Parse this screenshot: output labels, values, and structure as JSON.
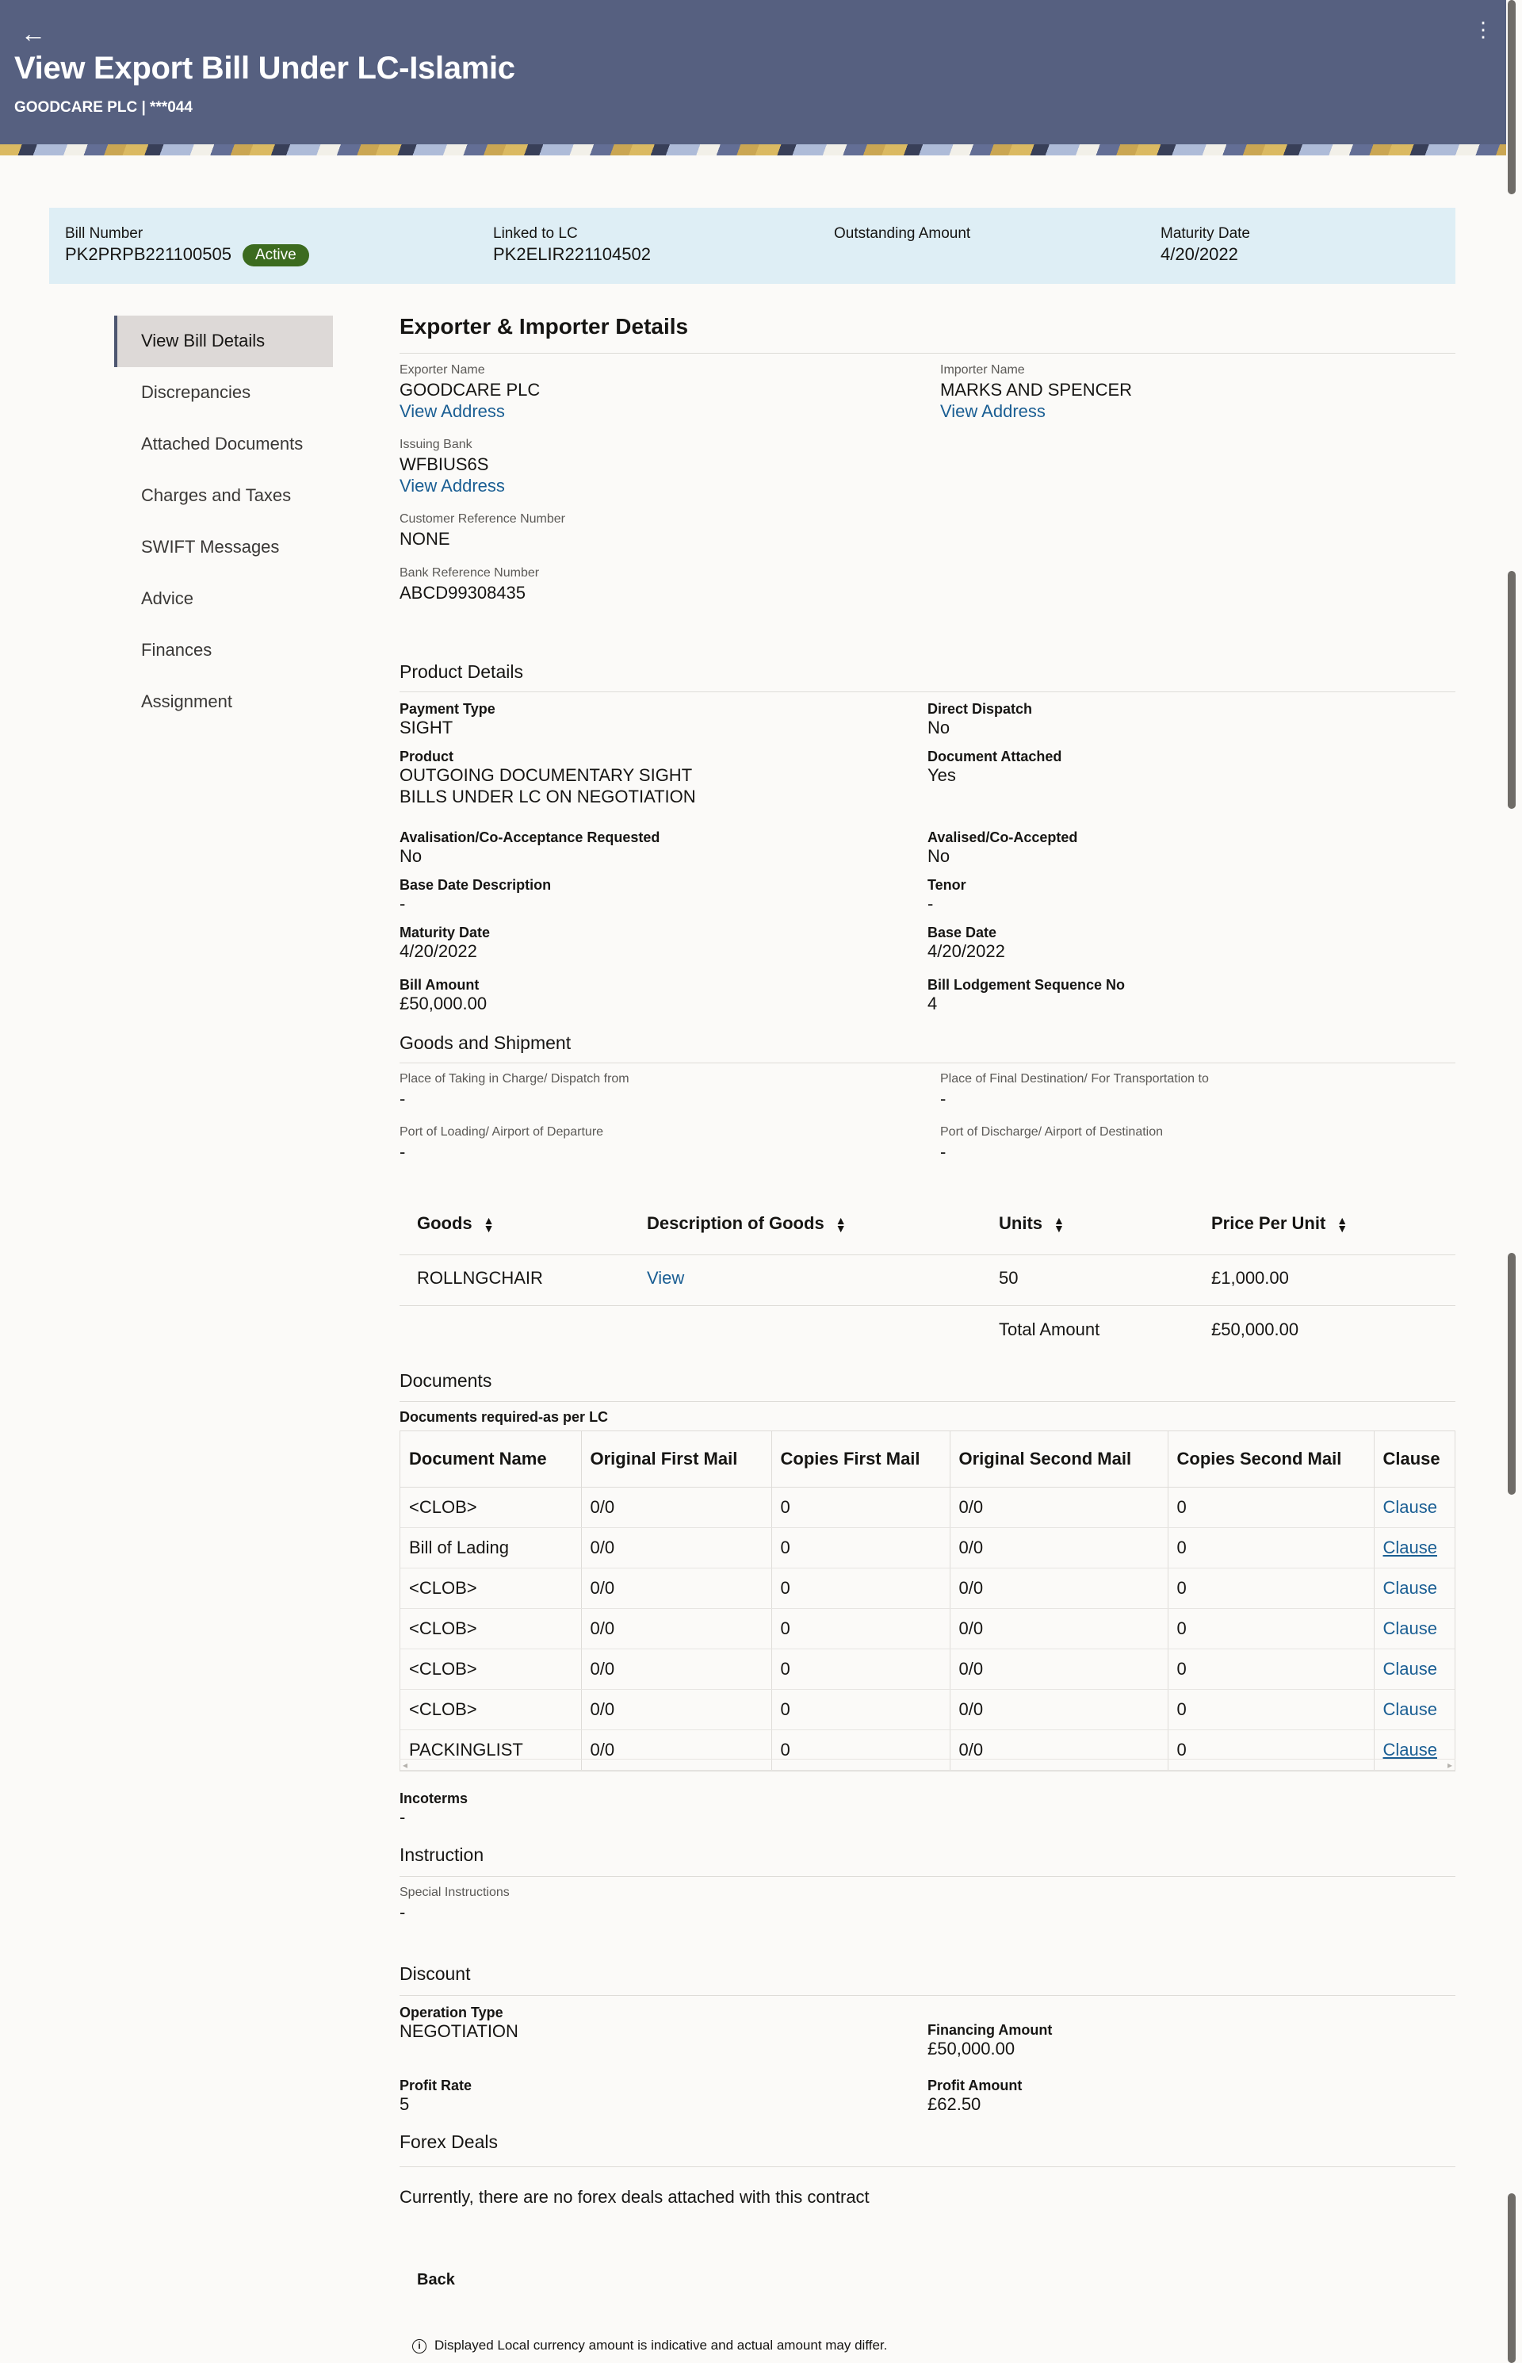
{
  "header": {
    "back_icon": "←",
    "title": "View Export Bill Under LC-Islamic",
    "subtitle": "GOODCARE PLC | ***044",
    "menu_icon": "⋮"
  },
  "summary": {
    "bill_number_label": "Bill Number",
    "bill_number": "PK2PRPB221100505",
    "status": "Active",
    "linked_lc_label": "Linked to LC",
    "linked_lc": "PK2ELIR221104502",
    "outstanding_label": "Outstanding Amount",
    "maturity_label": "Maturity Date",
    "maturity_date": "4/20/2022"
  },
  "nav": {
    "items": [
      "View Bill Details",
      "Discrepancies",
      "Attached Documents",
      "Charges and Taxes",
      "SWIFT Messages",
      "Advice",
      "Finances",
      "Assignment"
    ]
  },
  "exporter_importer": {
    "heading": "Exporter & Importer Details",
    "exporter_name_label": "Exporter Name",
    "exporter_name": "GOODCARE PLC",
    "importer_name_label": "Importer Name",
    "importer_name": "MARKS AND SPENCER",
    "view_address": "View Address",
    "issuing_bank_label": "Issuing Bank",
    "issuing_bank": "WFBIUS6S",
    "customer_ref_label": "Customer Reference Number",
    "customer_ref": "NONE",
    "bank_ref_label": "Bank Reference Number",
    "bank_ref": "ABCD99308435"
  },
  "product": {
    "heading": "Product Details",
    "payment_type_label": "Payment Type",
    "payment_type": "SIGHT",
    "direct_dispatch_label": "Direct Dispatch",
    "direct_dispatch": "No",
    "product_label": "Product",
    "product_line1": "OUTGOING DOCUMENTARY SIGHT",
    "product_line2": "BILLS UNDER LC ON NEGOTIATION",
    "doc_attached_label": "Document Attached",
    "doc_attached": "Yes",
    "avalisation_req_label": "Avalisation/Co-Acceptance Requested",
    "avalisation_req": "No",
    "avalised_label": "Avalised/Co-Accepted",
    "avalised": "No",
    "base_date_desc_label": "Base Date Description",
    "base_date_desc": "-",
    "tenor_label": "Tenor",
    "tenor": "-",
    "maturity_label": "Maturity Date",
    "maturity": "4/20/2022",
    "base_date_label": "Base Date",
    "base_date": "4/20/2022",
    "bill_amount_label": "Bill Amount",
    "bill_amount": "£50,000.00",
    "lodgement_seq_label": "Bill Lodgement Sequence No",
    "lodgement_seq": "4"
  },
  "goods_shipment": {
    "heading": "Goods and Shipment",
    "taking_charge_label": "Place of Taking in Charge/ Dispatch from",
    "taking_charge": "-",
    "final_dest_label": "Place of Final Destination/ For Transportation to",
    "final_dest": "-",
    "port_loading_label": "Port of Loading/ Airport of Departure",
    "port_loading": "-",
    "port_discharge_label": "Port of Discharge/ Airport of Destination",
    "port_discharge": "-"
  },
  "goods_table": {
    "headers": [
      "Goods",
      "Description of Goods",
      "Units",
      "Price Per Unit"
    ],
    "row": {
      "goods": "ROLLNGCHAIR",
      "description": "View",
      "units": "50",
      "price": "£1,000.00"
    },
    "total_label": "Total Amount",
    "total_value": "£50,000.00"
  },
  "documents": {
    "heading": "Documents",
    "subheading": "Documents required-as per LC",
    "headers": [
      "Document Name",
      "Original First Mail",
      "Copies First Mail",
      "Original Second Mail",
      "Copies Second Mail",
      "Clause"
    ],
    "rows": [
      [
        "<CLOB>",
        "0/0",
        "0",
        "0/0",
        "0",
        "Clause"
      ],
      [
        "Bill of Lading",
        "0/0",
        "0",
        "0/0",
        "0",
        "Clause"
      ],
      [
        "<CLOB>",
        "0/0",
        "0",
        "0/0",
        "0",
        "Clause"
      ],
      [
        "<CLOB>",
        "0/0",
        "0",
        "0/0",
        "0",
        "Clause"
      ],
      [
        "<CLOB>",
        "0/0",
        "0",
        "0/0",
        "0",
        "Clause"
      ],
      [
        "<CLOB>",
        "0/0",
        "0",
        "0/0",
        "0",
        "Clause"
      ],
      [
        "PACKINGLIST",
        "0/0",
        "0",
        "0/0",
        "0",
        "Clause"
      ]
    ],
    "incoterms_label": "Incoterms",
    "incoterms": "-"
  },
  "instruction": {
    "heading": "Instruction",
    "special_label": "Special Instructions",
    "special": "-"
  },
  "discount": {
    "heading": "Discount",
    "operation_type_label": "Operation Type",
    "operation_type": "NEGOTIATION",
    "financing_amount_label": "Financing Amount",
    "financing_amount": "£50,000.00",
    "profit_rate_label": "Profit Rate",
    "profit_rate": "5",
    "profit_amount_label": "Profit Amount",
    "profit_amount": "£62.50"
  },
  "forex": {
    "heading": "Forex Deals",
    "message": "Currently, there are no forex deals attached with this contract"
  },
  "footer": {
    "back_button": "Back",
    "note": "Displayed Local currency amount is indicative and actual amount may differ.",
    "info_icon": "i"
  }
}
